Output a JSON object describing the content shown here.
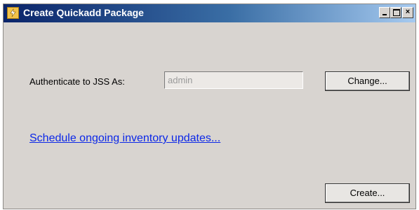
{
  "window": {
    "title": "Create Quickadd Package",
    "icon": "lightning-app-icon",
    "controls": {
      "minimize": "",
      "maximize": "",
      "close": "×"
    }
  },
  "auth": {
    "label": "Authenticate to JSS As:",
    "value": "admin",
    "change_label": "Change..."
  },
  "schedule_link": "Schedule ongoing inventory updates...",
  "create_label": "Create..."
}
